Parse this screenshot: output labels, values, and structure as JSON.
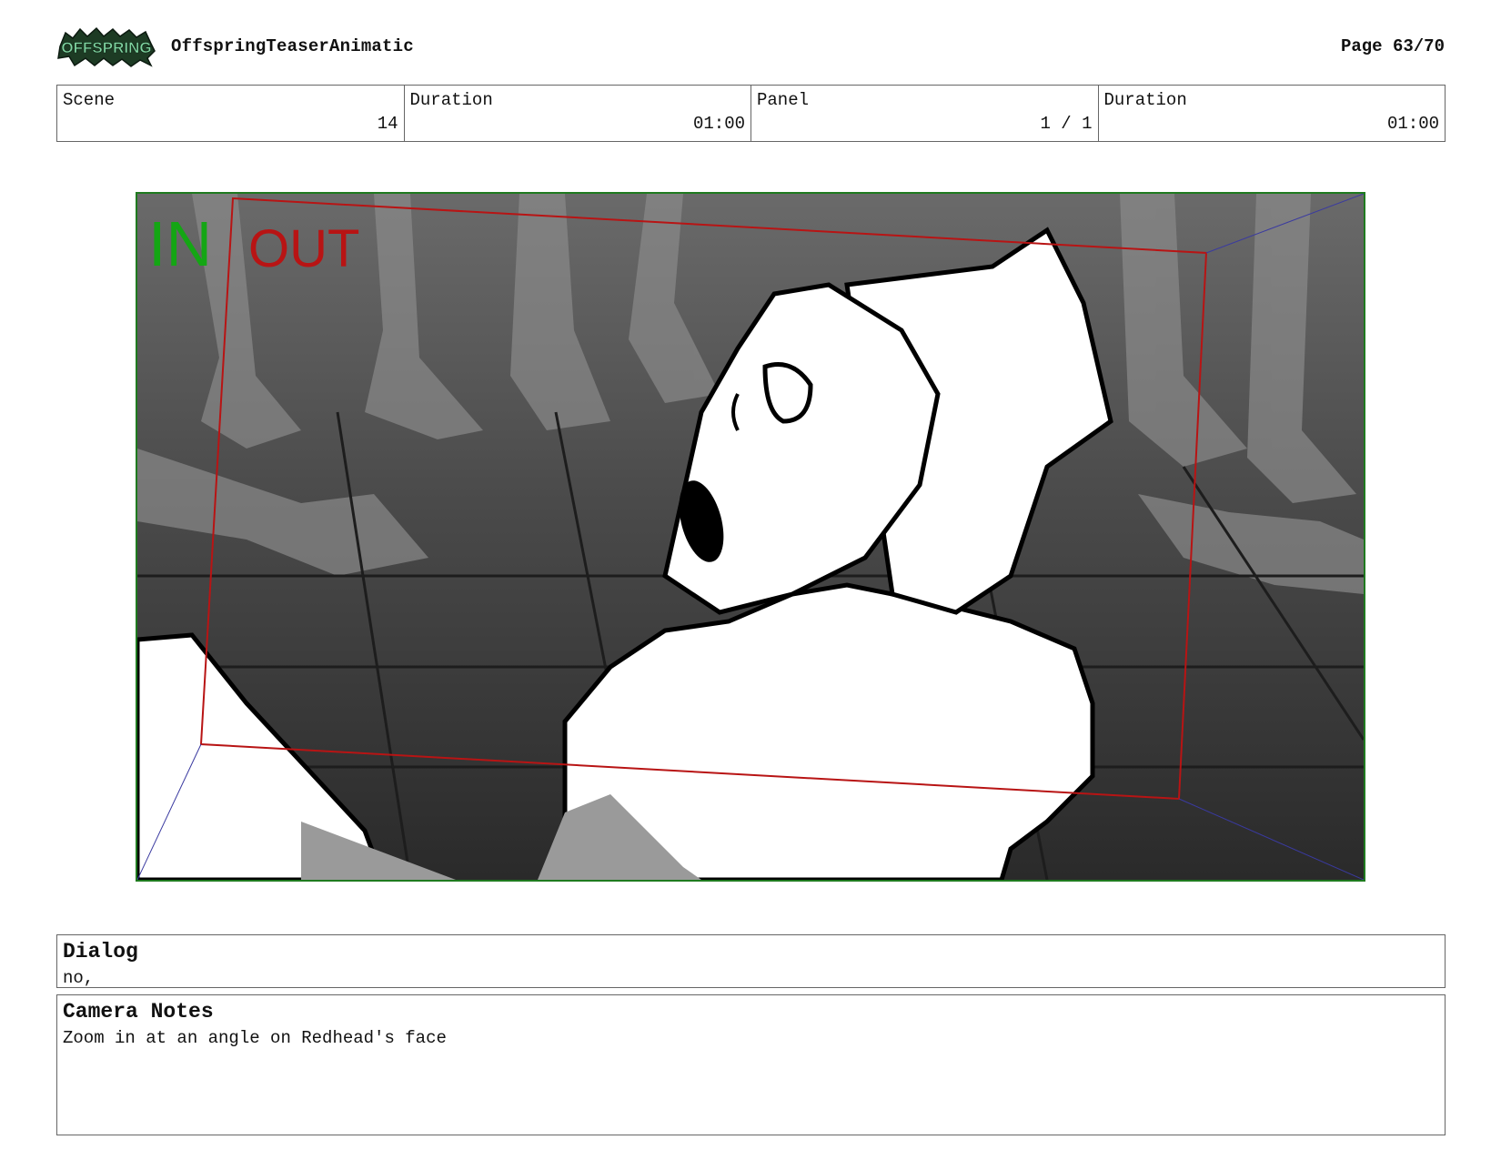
{
  "header": {
    "logo_text": "OFFSPRING",
    "title": "OffspringTeaserAnimatic",
    "page": "Page 63/70"
  },
  "info": {
    "scene_label": "Scene",
    "scene_value": "14",
    "scene_duration_label": "Duration",
    "scene_duration_value": "01:00",
    "panel_label": "Panel",
    "panel_value": "1 / 1",
    "panel_duration_label": "Duration",
    "panel_duration_value": "01:00"
  },
  "frame": {
    "in_label": "IN",
    "out_label": "OUT",
    "in_color": "#14a614",
    "out_color": "#b81414",
    "border_color": "#1f7a1f"
  },
  "dialog": {
    "title": "Dialog",
    "text": "no,"
  },
  "camera_notes": {
    "title": "Camera Notes",
    "text": "Zoom in at an angle on Redhead's face"
  }
}
